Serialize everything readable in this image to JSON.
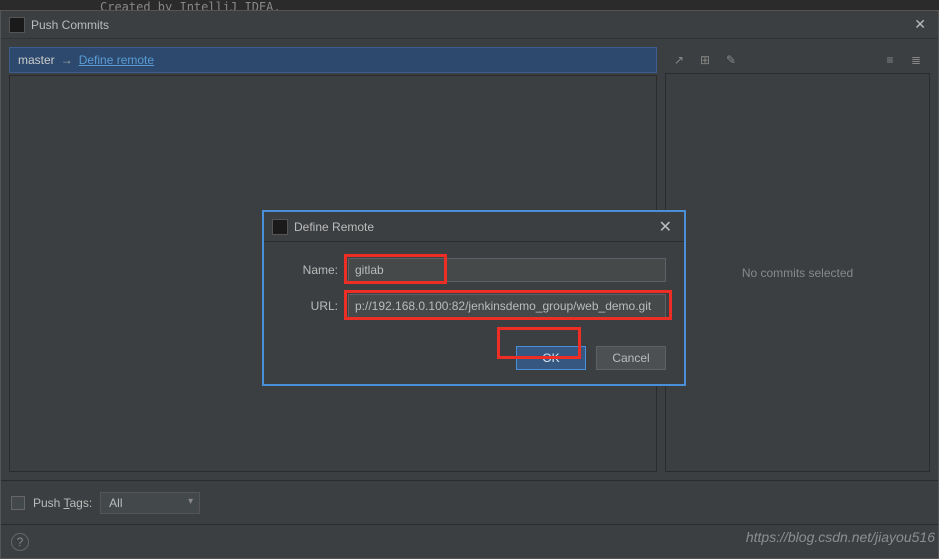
{
  "code_fragment": "Created by IntelliJ IDEA.",
  "window": {
    "title": "Push Commits",
    "branch_label": "master",
    "branch_arrow": "→",
    "define_remote_link": "Define remote"
  },
  "right_panel": {
    "empty_text": "No commits selected"
  },
  "bottom": {
    "push_tags_label": "Push Tags:",
    "push_tags_underline": "T",
    "dropdown_value": "All"
  },
  "modal": {
    "title": "Define Remote",
    "name_label": "Name:",
    "name_value": "gitlab",
    "url_label": "URL:",
    "url_value": "p://192.168.0.100:82/jenkinsdemo_group/web_demo.git",
    "ok": "OK",
    "cancel": "Cancel"
  },
  "watermark": "https://blog.csdn.net/jiayou516"
}
